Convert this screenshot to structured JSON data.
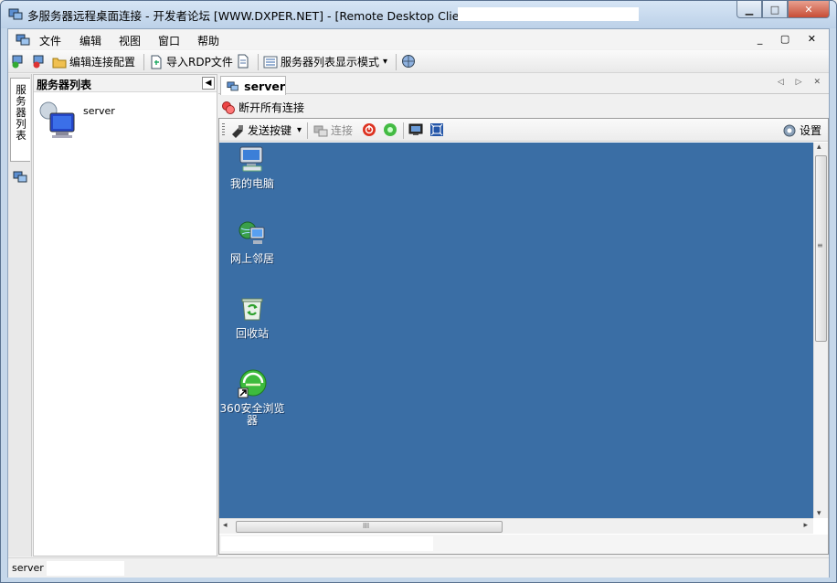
{
  "window": {
    "title": "多服务器远程桌面连接 - 开发者论坛 [WWW.DXPER.NET] - [Remote Desktop Client -",
    "min_glyph": "▁",
    "max_glyph": "□",
    "close_glyph": "✕"
  },
  "menubar": {
    "items": [
      "文件",
      "编辑",
      "视图",
      "窗口",
      "帮助"
    ],
    "mdi_controls": "_ ▢ ✕"
  },
  "toolbar": {
    "edit_config_label": "编辑连接配置",
    "import_rdp_label": "导入RDP文件",
    "list_mode_label": "服务器列表显示模式",
    "dropdown_glyph": "▾"
  },
  "side_tab": {
    "label": "服务器列表"
  },
  "server_panel": {
    "title": "服务器列表",
    "collapse_glyph": "◀",
    "servers": [
      {
        "name": "server"
      }
    ]
  },
  "doc_tabs": {
    "active_tab": "server",
    "nav_glyphs": "◁ ▷ ✕"
  },
  "disconnect_all_label": "断开所有连接",
  "rdp_toolbar": {
    "send_keys_label": "发送按键",
    "connect_label": "连接",
    "settings_label": "设置",
    "dropdown_glyph": "▾"
  },
  "desktop": {
    "icons": [
      {
        "label": "我的电脑",
        "icon": "my-computer-icon"
      },
      {
        "label": "网上邻居",
        "icon": "network-places-icon"
      },
      {
        "label": "回收站",
        "icon": "recycle-bin-icon"
      },
      {
        "label": "360安全浏览器",
        "icon": "360-browser-icon"
      }
    ]
  },
  "scrollbars": {
    "grip_glyph": "≡",
    "h_grip_glyph": "III",
    "left_glyph": "◂",
    "right_glyph": "▸",
    "up_glyph": "▴",
    "down_glyph": "▾"
  },
  "statusbar": {
    "text": "server -"
  },
  "colors": {
    "desktop_bg": "#3a6ea5",
    "title_bar": "#c5d7ea",
    "close_button": "#c74d36"
  }
}
